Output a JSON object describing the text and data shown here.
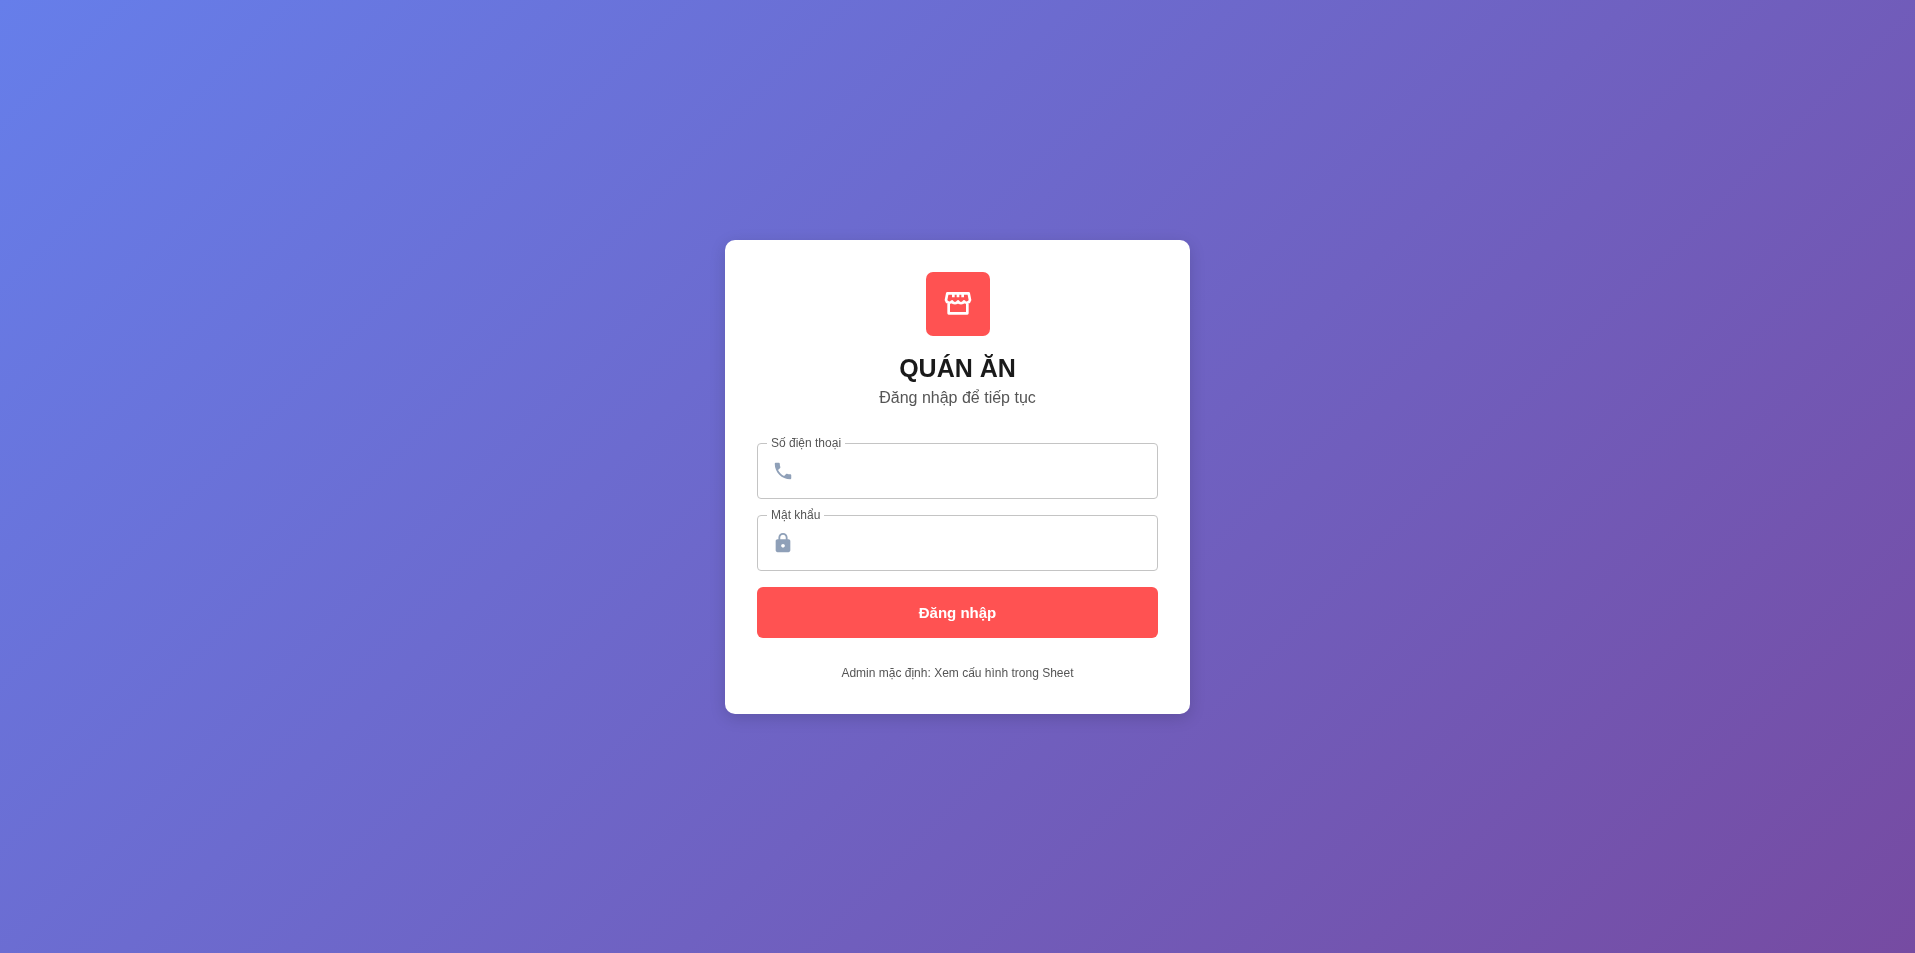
{
  "brand": {
    "title": "QUÁN ĂN",
    "subtitle": "Đăng nhập để tiếp tục"
  },
  "fields": [
    {
      "kind": "phone",
      "label": "Số điện thoại"
    },
    {
      "kind": "password",
      "label": "Mật khẩu"
    }
  ],
  "submit": {
    "label": "Đăng nhập"
  },
  "note": "Admin mặc định: Xem cấu hình trong Sheet"
}
